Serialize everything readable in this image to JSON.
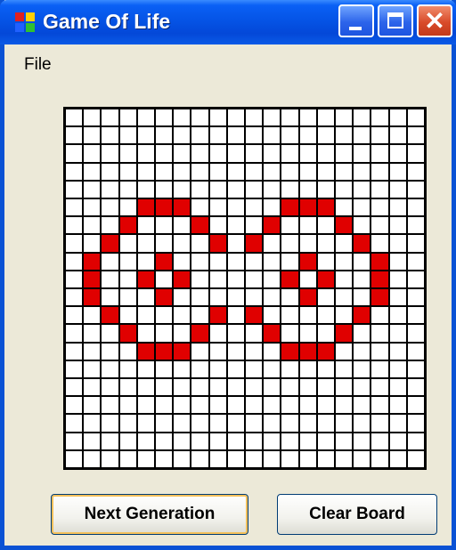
{
  "window": {
    "title": "Game Of Life",
    "icon": "app-grid-icon",
    "controls": {
      "minimize": "minimize-icon",
      "maximize": "maximize-icon",
      "close_label": "✕"
    }
  },
  "menu": {
    "items": [
      "File"
    ]
  },
  "board": {
    "rows": 20,
    "cols": 20,
    "alive_color": "#e00000",
    "dead_color": "#ffffff",
    "grid_color": "#000000",
    "alive_cells": [
      [
        5,
        4
      ],
      [
        5,
        5
      ],
      [
        5,
        6
      ],
      [
        5,
        12
      ],
      [
        5,
        13
      ],
      [
        5,
        14
      ],
      [
        6,
        3
      ],
      [
        6,
        7
      ],
      [
        6,
        11
      ],
      [
        6,
        15
      ],
      [
        7,
        2
      ],
      [
        7,
        8
      ],
      [
        7,
        10
      ],
      [
        7,
        16
      ],
      [
        8,
        1
      ],
      [
        8,
        5
      ],
      [
        8,
        13
      ],
      [
        8,
        17
      ],
      [
        9,
        1
      ],
      [
        9,
        4
      ],
      [
        9,
        6
      ],
      [
        9,
        12
      ],
      [
        9,
        14
      ],
      [
        9,
        17
      ],
      [
        10,
        1
      ],
      [
        10,
        5
      ],
      [
        10,
        13
      ],
      [
        10,
        17
      ],
      [
        11,
        2
      ],
      [
        11,
        8
      ],
      [
        11,
        10
      ],
      [
        11,
        16
      ],
      [
        12,
        3
      ],
      [
        12,
        7
      ],
      [
        12,
        11
      ],
      [
        12,
        15
      ],
      [
        13,
        4
      ],
      [
        13,
        5
      ],
      [
        13,
        6
      ],
      [
        13,
        12
      ],
      [
        13,
        13
      ],
      [
        13,
        14
      ]
    ]
  },
  "buttons": {
    "next_generation": "Next Generation",
    "clear_board": "Clear Board"
  }
}
